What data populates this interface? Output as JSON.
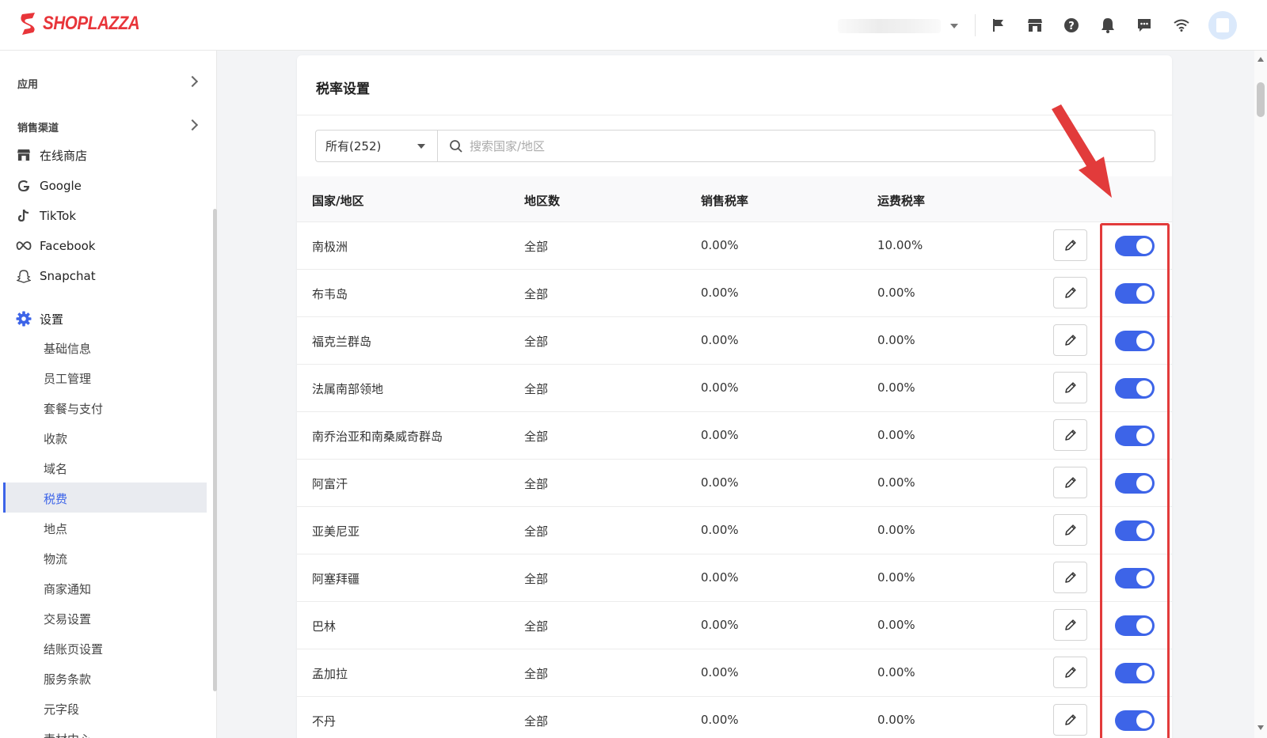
{
  "brand": {
    "name": "SHOPLAZZA",
    "color": "#e8353a"
  },
  "header": {
    "icons": [
      "flag-icon",
      "store-icon",
      "help-icon",
      "bell-icon",
      "message-icon",
      "wifi-icon"
    ]
  },
  "sidebar": {
    "apps_label": "应用",
    "channels_label": "销售渠道",
    "channels": [
      {
        "label": "在线商店",
        "icon": "store-icon"
      },
      {
        "label": "Google",
        "icon": "google-icon"
      },
      {
        "label": "TikTok",
        "icon": "tiktok-icon"
      },
      {
        "label": "Facebook",
        "icon": "meta-icon"
      },
      {
        "label": "Snapchat",
        "icon": "snapchat-icon"
      }
    ],
    "settings_label": "设置",
    "settings_items": [
      "基础信息",
      "员工管理",
      "套餐与支付",
      "收款",
      "域名",
      "税费",
      "地点",
      "物流",
      "商家通知",
      "交易设置",
      "结账页设置",
      "服务条款",
      "元字段",
      "素材中心"
    ],
    "active_item": "税费",
    "accent_color": "#3d64e8"
  },
  "main": {
    "title": "税率设置",
    "filter": {
      "selected": "所有(252)"
    },
    "search": {
      "placeholder": "搜索国家/地区",
      "value": ""
    },
    "columns": [
      "国家/地区",
      "地区数",
      "销售税率",
      "运费税率"
    ],
    "rows": [
      {
        "country": "南极洲",
        "regions": "全部",
        "sales_tax": "0.00%",
        "shipping_tax": "10.00%",
        "enabled": true
      },
      {
        "country": "布韦岛",
        "regions": "全部",
        "sales_tax": "0.00%",
        "shipping_tax": "0.00%",
        "enabled": true
      },
      {
        "country": "福克兰群岛",
        "regions": "全部",
        "sales_tax": "0.00%",
        "shipping_tax": "0.00%",
        "enabled": true
      },
      {
        "country": "法属南部领地",
        "regions": "全部",
        "sales_tax": "0.00%",
        "shipping_tax": "0.00%",
        "enabled": true
      },
      {
        "country": "南乔治亚和南桑威奇群岛",
        "regions": "全部",
        "sales_tax": "0.00%",
        "shipping_tax": "0.00%",
        "enabled": true
      },
      {
        "country": "阿富汗",
        "regions": "全部",
        "sales_tax": "0.00%",
        "shipping_tax": "0.00%",
        "enabled": true
      },
      {
        "country": "亚美尼亚",
        "regions": "全部",
        "sales_tax": "0.00%",
        "shipping_tax": "0.00%",
        "enabled": true
      },
      {
        "country": "阿塞拜疆",
        "regions": "全部",
        "sales_tax": "0.00%",
        "shipping_tax": "0.00%",
        "enabled": true
      },
      {
        "country": "巴林",
        "regions": "全部",
        "sales_tax": "0.00%",
        "shipping_tax": "0.00%",
        "enabled": true
      },
      {
        "country": "孟加拉",
        "regions": "全部",
        "sales_tax": "0.00%",
        "shipping_tax": "0.00%",
        "enabled": true
      },
      {
        "country": "不丹",
        "regions": "全部",
        "sales_tax": "0.00%",
        "shipping_tax": "0.00%",
        "enabled": true
      }
    ],
    "toggle_color": "#3d64e8",
    "annotation_color": "#e23b3b"
  }
}
